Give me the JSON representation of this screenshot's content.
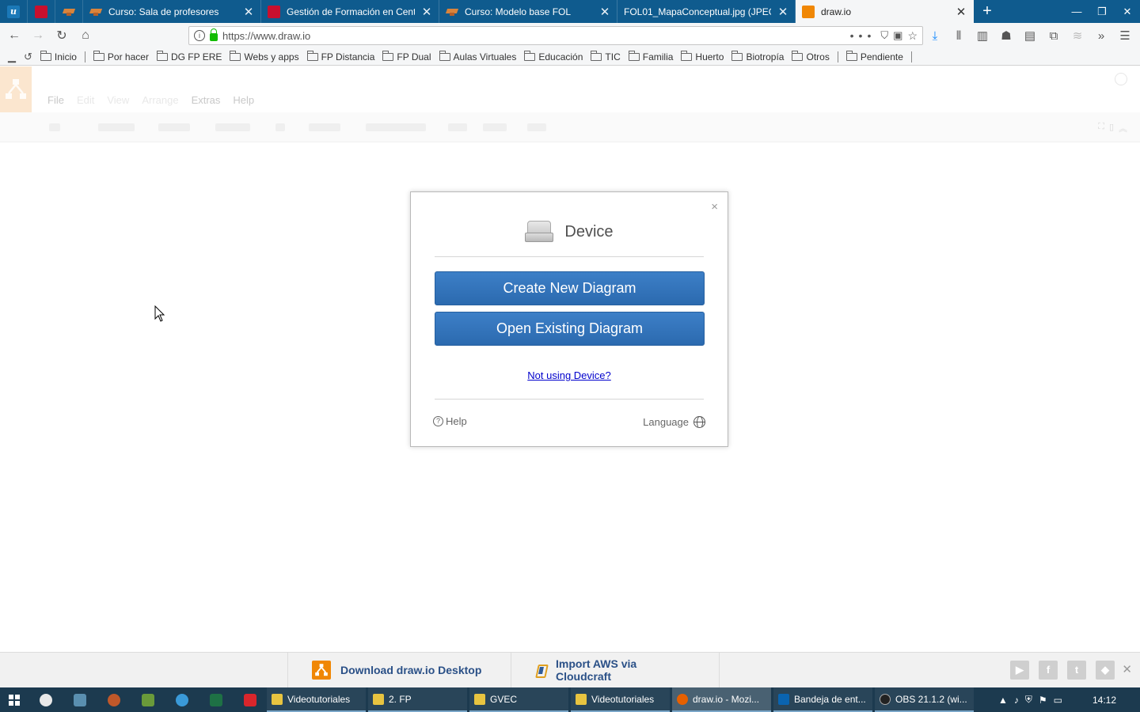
{
  "browser": {
    "tabs": [
      {
        "title": "Curso: Sala de profesores",
        "icon": "cap-icon"
      },
      {
        "title": "Gestión de Formación en Cent",
        "icon": "cm-icon"
      },
      {
        "title": "Curso: Modelo base FOL",
        "icon": "cap-icon"
      },
      {
        "title": "FOL01_MapaConceptual.jpg (JPEG",
        "icon": "cap-icon"
      },
      {
        "title": "draw.io",
        "icon": "drawio-icon",
        "active": true
      }
    ],
    "url": "https://www.draw.io",
    "bookmarks": [
      "Inicio",
      "Por hacer",
      "DG FP ERE",
      "Webs y apps",
      "FP Distancia",
      "FP Dual",
      "Aulas Virtuales",
      "Educación",
      "TIC",
      "Familia",
      "Huerto",
      "Biotropía",
      "Otros",
      "Pendiente"
    ]
  },
  "app": {
    "menu": [
      "File",
      "Edit",
      "View",
      "Arrange",
      "Extras",
      "Help"
    ]
  },
  "dialog": {
    "title": "Device",
    "create_label": "Create New Diagram",
    "open_label": "Open Existing Diagram",
    "not_using_label": "Not using Device?",
    "help_label": "Help",
    "language_label": "Language",
    "close_label": "×"
  },
  "footer": {
    "download_label": "Download draw.io Desktop",
    "import_label": "Import AWS via Cloudcraft"
  },
  "taskbar": {
    "items": [
      {
        "label": "Videotutoriales",
        "icon_color": "#e8c440"
      },
      {
        "label": "2. FP",
        "icon_color": "#e8c440"
      },
      {
        "label": "GVEC",
        "icon_color": "#e8c440"
      },
      {
        "label": "Videotutoriales",
        "icon_color": "#e8c440"
      },
      {
        "label": "draw.io - Mozi...",
        "icon_color": "#e66000",
        "active": true
      },
      {
        "label": "Bandeja de ent...",
        "icon_color": "#0a64b0"
      },
      {
        "label": "OBS 21.1.2 (wi...",
        "icon_color": "#222222"
      }
    ],
    "clock": "14:12"
  },
  "colors": {
    "tabstrip": "#0f5b8e",
    "accent_button": "#2b6aaf",
    "drawio_orange": "#f08705"
  }
}
